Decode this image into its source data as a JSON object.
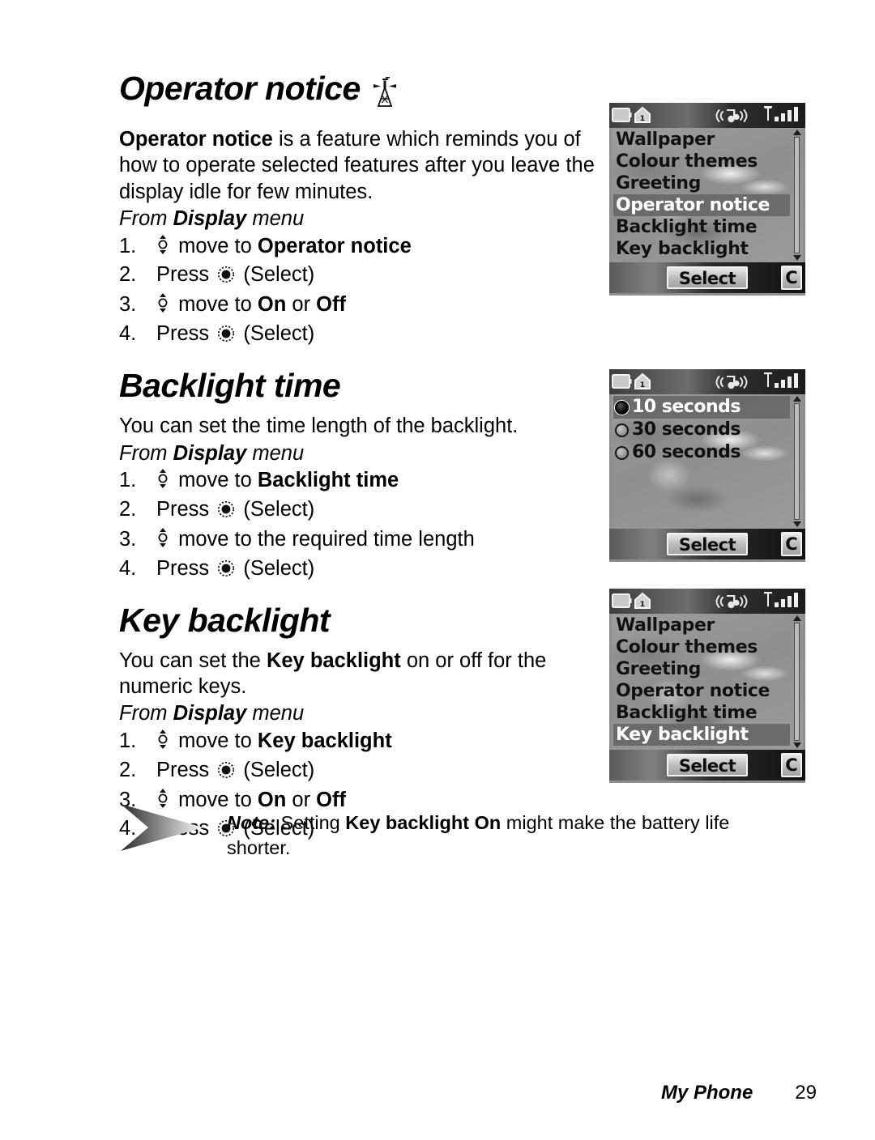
{
  "document": {
    "footer": {
      "book_title": "My Phone",
      "page_number": "29"
    }
  },
  "sections": [
    {
      "title": "Operator notice",
      "title_icon": "transmission-mast-icon",
      "paragraph_prefix": "Operator notice",
      "paragraph_rest": " is a feature which reminds you of how to operate selected features after you leave the display idle for few minutes.",
      "from_prefix": "From ",
      "from_bold": "Display",
      "from_suffix": " menu",
      "steps": [
        {
          "num": "1.",
          "icon": "nav-up-down-icon",
          "text_before": " move to ",
          "text_bold": "Operator notice",
          "text_after": ""
        },
        {
          "num": "2.",
          "icon": "select-key-icon",
          "text_before": "Press ",
          "text_bold": "",
          "text_after": " (Select)"
        },
        {
          "num": "3.",
          "icon": "nav-up-down-icon",
          "text_before": " move to ",
          "text_bold": "On",
          "text_mid": " or ",
          "text_bold2": "Off",
          "text_after": ""
        },
        {
          "num": "4.",
          "icon": "select-key-icon",
          "text_before": "Press ",
          "text_bold": "",
          "text_after": " (Select)"
        }
      ]
    },
    {
      "title": "Backlight time",
      "title_icon": "",
      "paragraph_prefix": "",
      "paragraph_rest": "You can set the time length of the backlight.",
      "from_prefix": "From ",
      "from_bold": "Display",
      "from_suffix": " menu",
      "steps": [
        {
          "num": "1.",
          "icon": "nav-up-down-icon",
          "text_before": " move to ",
          "text_bold": "Backlight time",
          "text_after": ""
        },
        {
          "num": "2.",
          "icon": "select-key-icon",
          "text_before": "Press ",
          "text_bold": "",
          "text_after": " (Select)"
        },
        {
          "num": "3.",
          "icon": "nav-up-down-icon",
          "text_before": " move to the required time length",
          "text_bold": "",
          "text_after": ""
        },
        {
          "num": "4.",
          "icon": "select-key-icon",
          "text_before": "Press ",
          "text_bold": "",
          "text_after": " (Select)"
        }
      ]
    },
    {
      "title": "Key backlight",
      "title_icon": "",
      "paragraph_prefix": "",
      "paragraph_rest": "You can set the Key backlight on or off for the numeric keys.",
      "from_prefix": "From ",
      "from_bold": "Display",
      "from_suffix": " menu",
      "steps": [
        {
          "num": "1.",
          "icon": "nav-up-down-icon",
          "text_before": " move to ",
          "text_bold": "Key backlight",
          "text_after": ""
        },
        {
          "num": "2.",
          "icon": "select-key-icon",
          "text_before": "Press ",
          "text_bold": "",
          "text_after": " (Select)"
        },
        {
          "num": "3.",
          "icon": "nav-up-down-icon",
          "text_before": " move to ",
          "text_bold": "On",
          "text_mid": " or ",
          "text_bold2": "Off",
          "text_after": ""
        },
        {
          "num": "4.",
          "icon": "select-key-icon",
          "text_before": "Press ",
          "text_bold": "",
          "text_after": " (Select)"
        }
      ]
    }
  ],
  "note": {
    "icon": "arrow-chevron-icon",
    "label": "Note:",
    "text_a": " Setting ",
    "text_bold": "Key backlight On",
    "text_b": " might make the battery life shorter."
  },
  "phone_screens": [
    {
      "name": "display-menu-operator-notice",
      "status_icons": [
        "battery-icon",
        "home-zone-icon",
        "ringtone-icon",
        "signal-strength-icon"
      ],
      "list_type": "menu",
      "items": [
        {
          "label": "Wallpaper",
          "selected": false
        },
        {
          "label": "Colour themes",
          "selected": false
        },
        {
          "label": "Greeting",
          "selected": false
        },
        {
          "label": "Operator notice",
          "selected": true
        },
        {
          "label": "Backlight time",
          "selected": false
        },
        {
          "label": "Key backlight",
          "selected": false
        }
      ],
      "softkey_left": "Select",
      "softkey_right": "C"
    },
    {
      "name": "backlight-time-options",
      "status_icons": [
        "battery-icon",
        "home-zone-icon",
        "ringtone-icon",
        "signal-strength-icon"
      ],
      "list_type": "radio",
      "items": [
        {
          "label": "10 seconds",
          "selected": true,
          "checked": true
        },
        {
          "label": "30 seconds",
          "selected": false,
          "checked": false
        },
        {
          "label": "60 seconds",
          "selected": false,
          "checked": false
        }
      ],
      "softkey_left": "Select",
      "softkey_right": "C"
    },
    {
      "name": "display-menu-key-backlight",
      "status_icons": [
        "battery-icon",
        "home-zone-icon",
        "ringtone-icon",
        "signal-strength-icon"
      ],
      "list_type": "menu",
      "items": [
        {
          "label": "Wallpaper",
          "selected": false
        },
        {
          "label": "Colour themes",
          "selected": false
        },
        {
          "label": "Greeting",
          "selected": false
        },
        {
          "label": "Operator notice",
          "selected": false
        },
        {
          "label": "Backlight time",
          "selected": false
        },
        {
          "label": "Key backlight",
          "selected": true
        }
      ],
      "softkey_left": "Select",
      "softkey_right": "C"
    }
  ],
  "colors": {
    "page_bg": "#ffffff",
    "text": "#000000",
    "screen_bg": "#9a9a9a",
    "highlight": "#6b6b6b",
    "status_bar": "#2e2e2e"
  }
}
